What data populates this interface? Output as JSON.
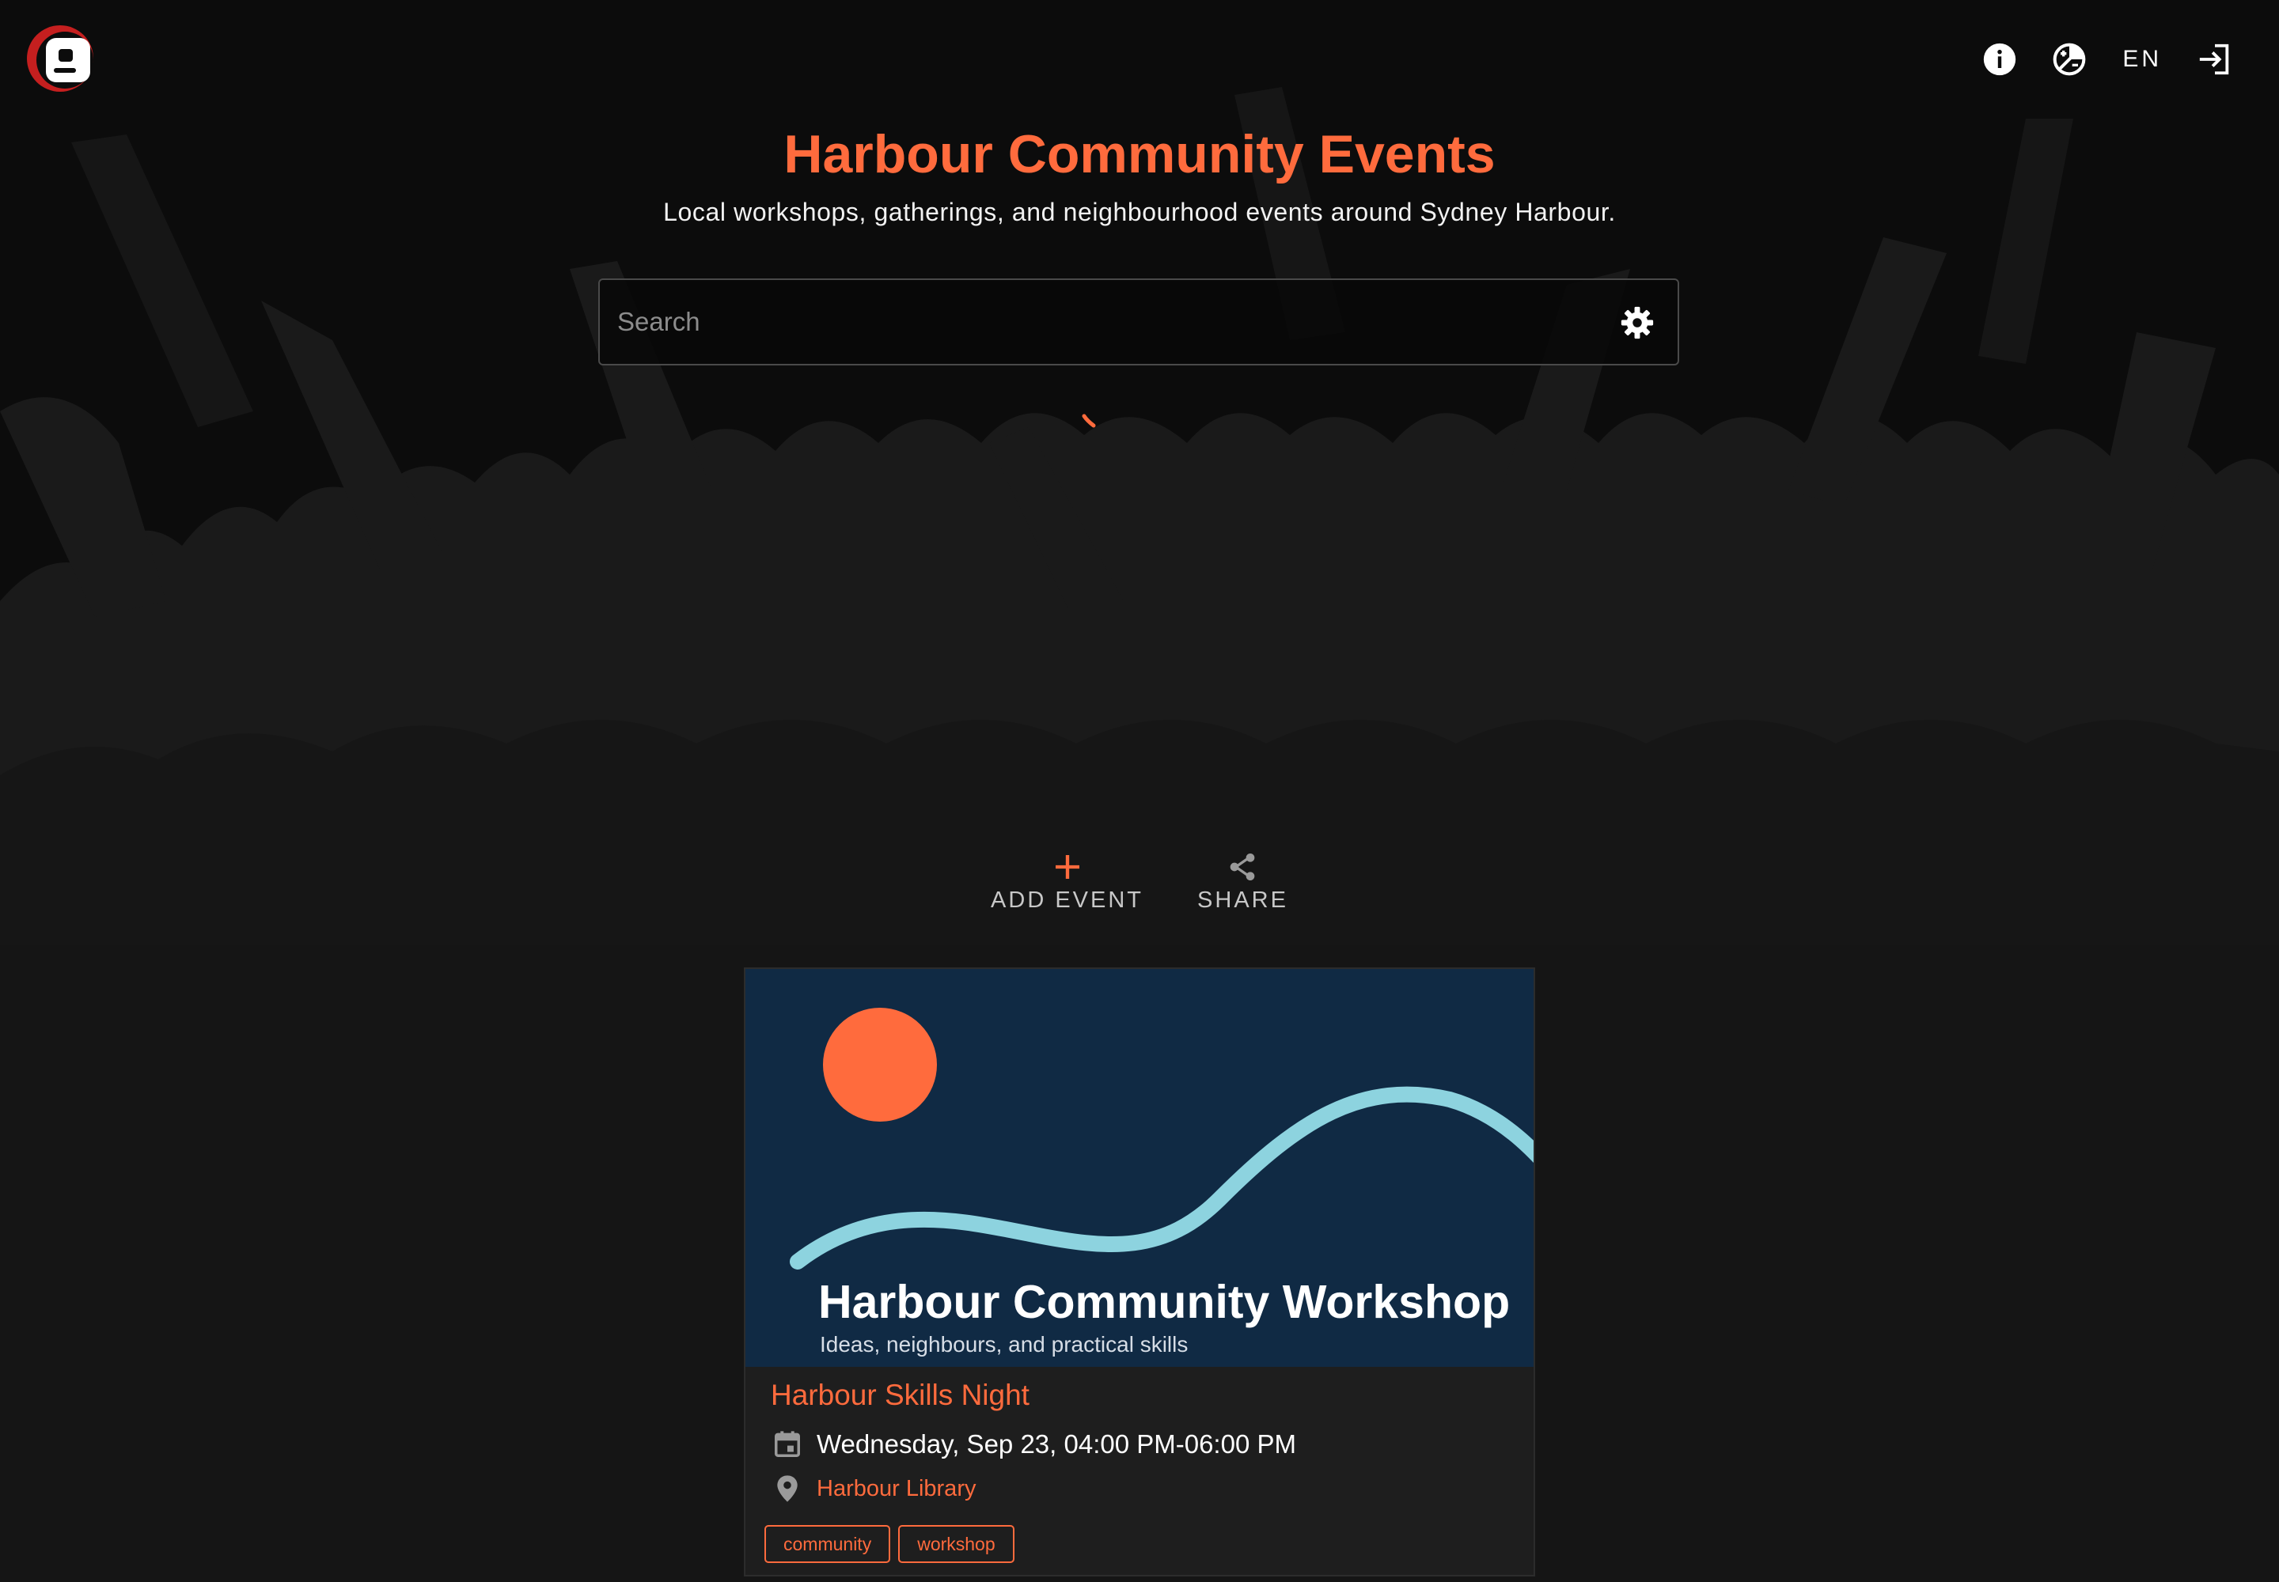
{
  "header": {
    "logo_icon": "brand-logo",
    "nav": {
      "info_icon": "info-icon",
      "theme_icon": "theme-toggle-icon",
      "language": "EN",
      "login_icon": "login-icon"
    }
  },
  "hero": {
    "title": "Harbour Community Events",
    "subtitle": "Local workshops, gatherings, and neighbourhood events around Sydney Harbour.",
    "search": {
      "placeholder": "Search",
      "value": ""
    },
    "loading": true
  },
  "actions": {
    "add_event": "ADD EVENT",
    "share": "SHARE"
  },
  "events": [
    {
      "image": {
        "heading": "Harbour Community Workshop",
        "tagline": "Ideas, neighbours, and practical skills"
      },
      "title": "Harbour Skills Night",
      "date": "Wednesday, Sep 23, 04:00 PM-06:00 PM",
      "place": "Harbour Library",
      "tags": [
        "community",
        "workshop"
      ]
    }
  ],
  "colors": {
    "accent": "#ff6b3d",
    "background": "#151515",
    "hero_background": "#0c0c0c",
    "card_background": "#1e1e1e",
    "image_sky": "#102a44",
    "image_wave": "#8dd3df"
  }
}
